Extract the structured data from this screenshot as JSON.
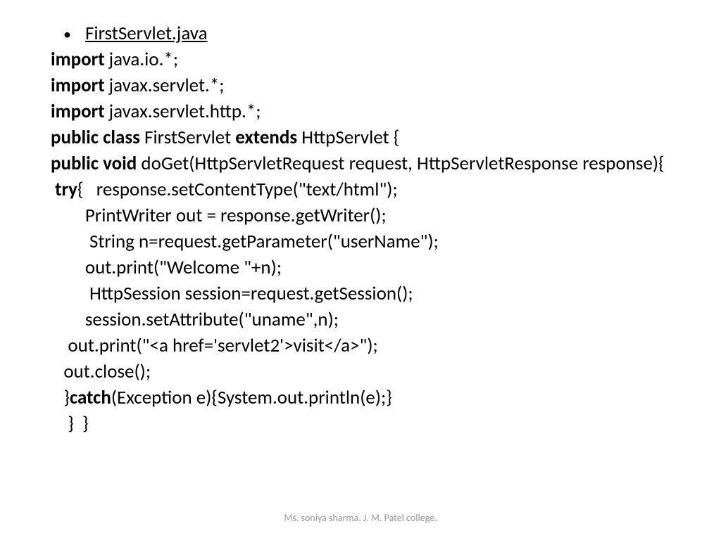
{
  "title": "FirstServlet.java",
  "lines": {
    "kw_import": "import",
    "l1_rest": " java.io.*;",
    "l2_rest": " javax.servlet.*;",
    "l3_rest": " javax.servlet.http.*;",
    "kw_public_class": "public class",
    "l4_mid": " FirstServlet ",
    "kw_extends": "extends",
    "l4_end": " HttpServlet {",
    "kw_public_void": "public void",
    "l5_rest": " doGet(HttpServletRequest request, HttpServletResponse response){",
    "l6_pre": " ",
    "kw_try": "try",
    "l6_rest": "{   response.setContentType(\"text/html\");",
    "l7": "        PrintWriter out = response.getWriter();",
    "l8": "         String n=request.getParameter(\"userName\");",
    "l9": "        out.print(\"Welcome \"+n);",
    "l10": "         HttpSession session=request.getSession();",
    "l11": "        session.setAttribute(\"uname\",n);",
    "l12": "    out.print(\"<a href='servlet2'>visit</a>\");",
    "l13": "   out.close();",
    "l14_pre": "   }",
    "kw_catch": "catch",
    "l14_rest": "(Exception e){System.out.println(e);}",
    "l15": "    }  }"
  },
  "footer": "Ms. soniya sharma. J. M. Patel college."
}
